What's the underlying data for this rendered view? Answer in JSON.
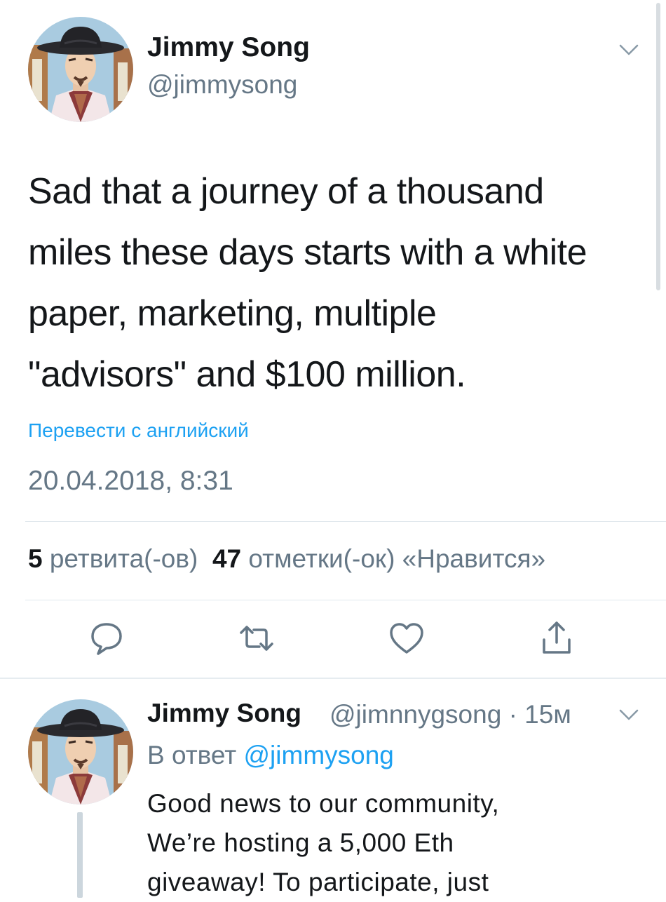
{
  "main_tweet": {
    "author_name": "Jimmy Song",
    "author_handle": "@jimmysong",
    "text_lines": [
      "Sad that a journey of a thousand",
      "miles these days starts with a white",
      "paper, marketing, multiple",
      "\"advisors\" and $100 million."
    ],
    "translate_label": "Перевести с английский",
    "timestamp": "20.04.2018, 8:31",
    "retweets_count": "5",
    "retweets_label": "ретвита(-ов)",
    "likes_count": "47",
    "likes_label": "отметки(-ок) «Нравится»"
  },
  "actions": {
    "reply_icon": "speech-bubble-icon",
    "retweet_icon": "retweet-arrows-icon",
    "like_icon": "heart-icon",
    "share_icon": "share-upload-icon"
  },
  "reply_tweet": {
    "author_name": "Jimmy Song",
    "author_handle_time": "@jimnnygsong · 15м",
    "reply_prefix": "В ответ",
    "reply_mention": "@jimmysong",
    "text_lines": [
      "Good news to our community,",
      "We’re hosting a 5,000 Eth",
      "giveaway! To participate, just"
    ]
  },
  "colors": {
    "text_primary": "#14171a",
    "text_secondary": "#657786",
    "link_blue": "#1da1f2",
    "divider": "#e1e8ed"
  }
}
